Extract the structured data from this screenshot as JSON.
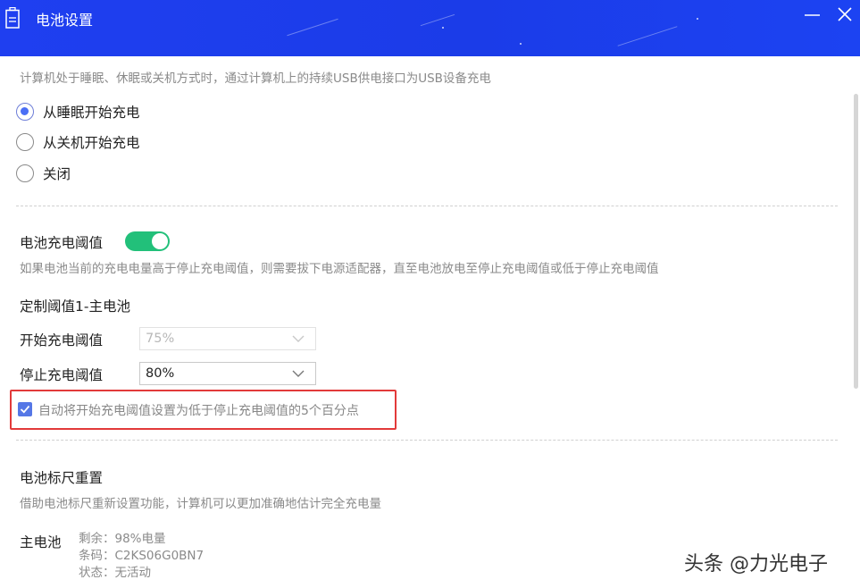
{
  "window": {
    "title": "电池设置",
    "minimize_icon": "minimize-icon",
    "close_icon": "close-icon",
    "accent": "#1f3ff0"
  },
  "usb_charging": {
    "description": "计算机处于睡眠、休眠或关机方式时，通过计算机上的持续USB供电接口为USB设备充电",
    "options": [
      {
        "label": "从睡眠开始充电",
        "selected": true
      },
      {
        "label": "从关机开始充电",
        "selected": false
      },
      {
        "label": "关闭",
        "selected": false
      }
    ]
  },
  "threshold": {
    "title": "电池充电阈值",
    "enabled": true,
    "description": "如果电池当前的充电电量高于停止充电阈值，则需要拔下电源适配器，直至电池放电至停止充电阈值或低于停止充电阈值",
    "custom_title": "定制阈值1-主电池",
    "start_label": "开始充电阈值",
    "start_value": "75%",
    "stop_label": "停止充电阈值",
    "stop_value": "80%",
    "auto_checkbox_label": "自动将开始充电阈值设置为低于停止充电阈值的5个百分点",
    "auto_checked": true,
    "toggle_color": "#22c07a"
  },
  "gauge_reset": {
    "title": "电池标尺重置",
    "description": "借助电池标尺重新设置功能，计算机可以更加准确地估计完全充电量",
    "battery_label": "主电池",
    "remaining": "剩余：98%电量",
    "barcode": "条码：C2KS06G0BN7",
    "status": "状态：无活动"
  },
  "watermark": "头条 @力光电子"
}
